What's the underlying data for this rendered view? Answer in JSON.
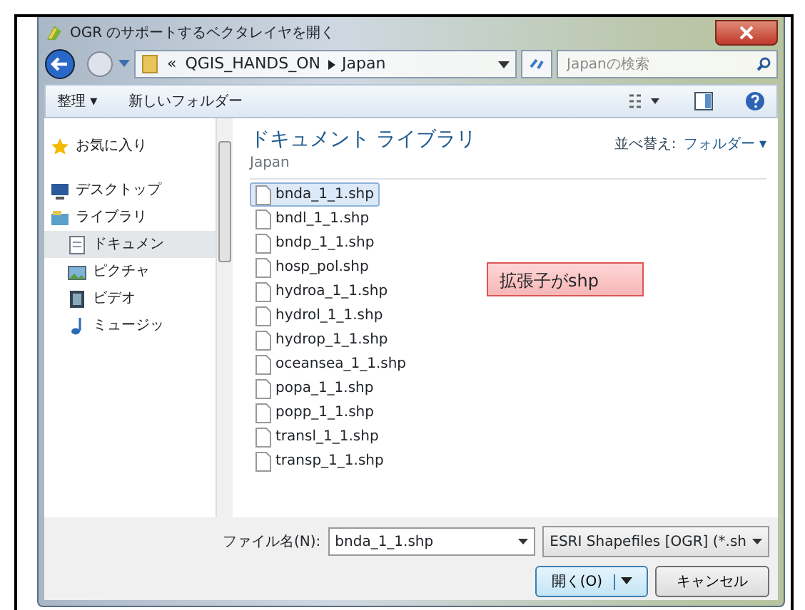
{
  "window": {
    "title": "OGR のサポートするベクタレイヤを開く"
  },
  "address": {
    "overflow": "«",
    "path": [
      "QGIS_HANDS_ON",
      "Japan"
    ]
  },
  "search": {
    "placeholder": "Japanの検索"
  },
  "toolbar": {
    "organize": "整理 ▾",
    "new_folder": "新しいフォルダー"
  },
  "sidebar": {
    "items": [
      {
        "label": "お気に入り",
        "kind": "star",
        "selected": false
      },
      {
        "label": "デスクトップ",
        "kind": "desktop",
        "selected": false
      },
      {
        "label": "ライブラリ",
        "kind": "library",
        "selected": false,
        "children": [
          {
            "label": "ドキュメン",
            "kind": "document",
            "selected": true
          },
          {
            "label": "ピクチャ",
            "kind": "picture",
            "selected": false
          },
          {
            "label": "ビデオ",
            "kind": "video",
            "selected": false
          },
          {
            "label": "ミュージッ",
            "kind": "music",
            "selected": false
          }
        ]
      }
    ]
  },
  "library": {
    "title": "ドキュメント ライブラリ",
    "subtitle": "Japan",
    "sort_label": "並べ替え:",
    "sort_value": "フォルダー ▾"
  },
  "files": [
    {
      "name": "bnda_1_1.shp",
      "selected": true
    },
    {
      "name": "bndl_1_1.shp",
      "selected": false
    },
    {
      "name": "bndp_1_1.shp",
      "selected": false
    },
    {
      "name": "hosp_pol.shp",
      "selected": false
    },
    {
      "name": "hydroa_1_1.shp",
      "selected": false
    },
    {
      "name": "hydrol_1_1.shp",
      "selected": false
    },
    {
      "name": "hydrop_1_1.shp",
      "selected": false
    },
    {
      "name": "oceansea_1_1.shp",
      "selected": false
    },
    {
      "name": "popa_1_1.shp",
      "selected": false
    },
    {
      "name": "popp_1_1.shp",
      "selected": false
    },
    {
      "name": "transl_1_1.shp",
      "selected": false
    },
    {
      "name": "transp_1_1.shp",
      "selected": false
    }
  ],
  "callout": {
    "text": "拡張子がshp"
  },
  "footer": {
    "filename_label": "ファイル名(N):",
    "filename": "bnda_1_1.shp",
    "filter": "ESRI Shapefiles [OGR] (*.sh",
    "open": "開く(O)",
    "cancel": "キャンセル"
  }
}
